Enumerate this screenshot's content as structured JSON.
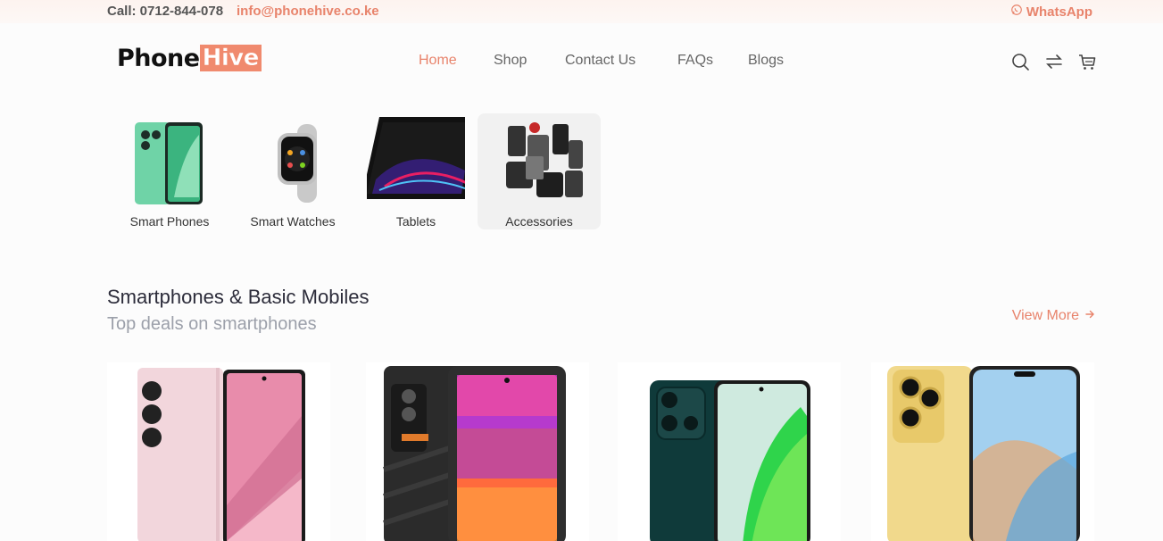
{
  "topbar": {
    "call": "Call: 0712-844-078",
    "email": "info@phonehive.co.ke",
    "whatsapp": "WhatsApp"
  },
  "logo": {
    "part1": "Phone",
    "part2": "Hive"
  },
  "nav": {
    "items": [
      {
        "label": "Home",
        "active": true
      },
      {
        "label": "Shop",
        "active": false
      },
      {
        "label": "Contact Us",
        "active": false
      },
      {
        "label": "FAQs",
        "active": false
      },
      {
        "label": "Blogs",
        "active": false
      }
    ]
  },
  "header_icons": [
    "search-icon",
    "compare-icon",
    "cart-icon"
  ],
  "categories": [
    {
      "label": "Smart Phones",
      "selected": false
    },
    {
      "label": "Smart Watches",
      "selected": false
    },
    {
      "label": "Tablets",
      "selected": false
    },
    {
      "label": "Accessories",
      "selected": true
    }
  ],
  "section": {
    "title": "Smartphones & Basic Mobiles",
    "subtitle": "Top deals on smartphones",
    "view_more": "View More"
  },
  "colors": {
    "accent": "#e8836b",
    "text_dark": "#2c2c3a",
    "text_muted": "#9ca0aa"
  }
}
